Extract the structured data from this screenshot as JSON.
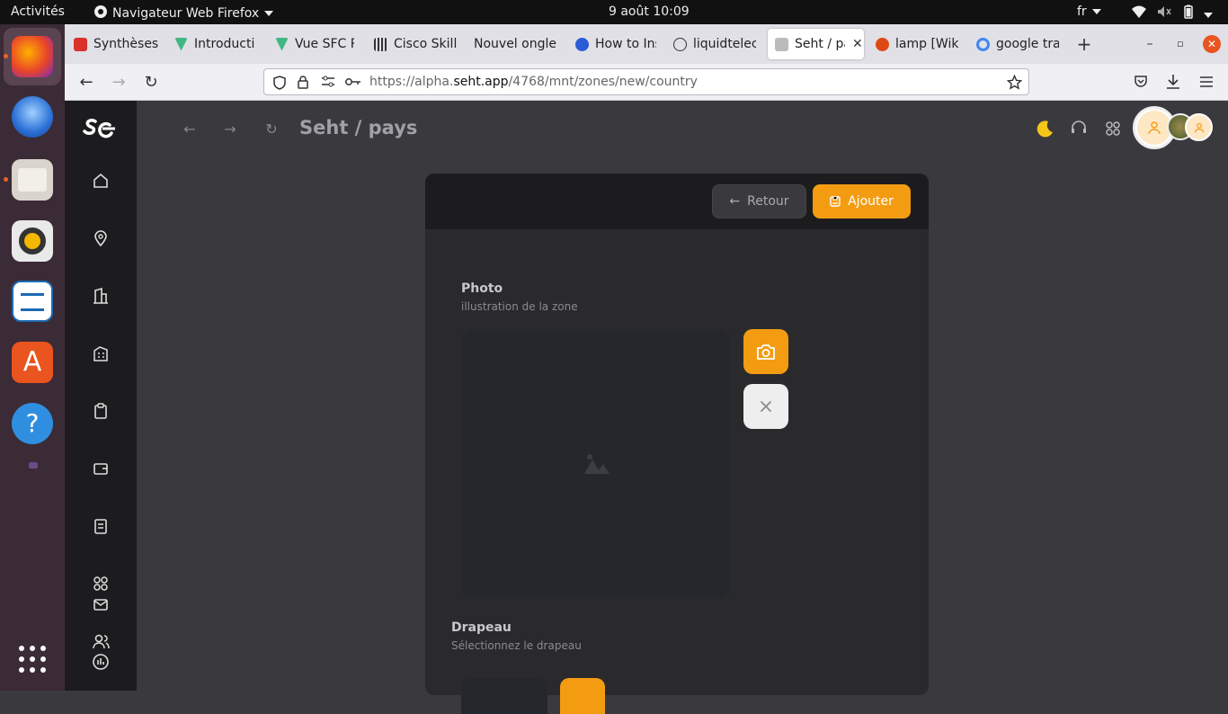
{
  "system_bar": {
    "activities": "Activités",
    "app_menu": "Navigateur Web Firefox",
    "datetime": "9 août  10:09",
    "lang": "fr"
  },
  "browser": {
    "tabs": [
      {
        "label": "Synthèses",
        "fav_color": "#d8322a"
      },
      {
        "label": "Introducti",
        "fav_color": "#41b883"
      },
      {
        "label": "Vue SFC Pl",
        "fav_color": "#41b883"
      },
      {
        "label": "Cisco Skills",
        "fav_color": "#333333"
      },
      {
        "label": "Nouvel onglet",
        "fav_color": ""
      },
      {
        "label": "How to Ins",
        "fav_color": "#2b5bd7"
      },
      {
        "label": "liquidtelec",
        "fav_color": ""
      },
      {
        "label": "Seht / pays",
        "fav_color": "#bbbbbb"
      },
      {
        "label": "lamp [Wiki",
        "fav_color": "#dd4814"
      },
      {
        "label": "google tra",
        "fav_color": "#4285f4"
      }
    ],
    "active_tab_index": 7,
    "url_prefix": "https://alpha.",
    "url_domain": "seht.app",
    "url_path": "/4768/mnt/zones/new/country"
  },
  "app": {
    "page_title": "Seht / pays",
    "accent_color": "#f39c12",
    "actions": {
      "back_label": "Retour",
      "add_label": "Ajouter"
    },
    "photo": {
      "label": "Photo",
      "description": "illustration de la zone"
    },
    "flag": {
      "label": "Drapeau",
      "description": "Sélectionnez le drapeau"
    }
  }
}
